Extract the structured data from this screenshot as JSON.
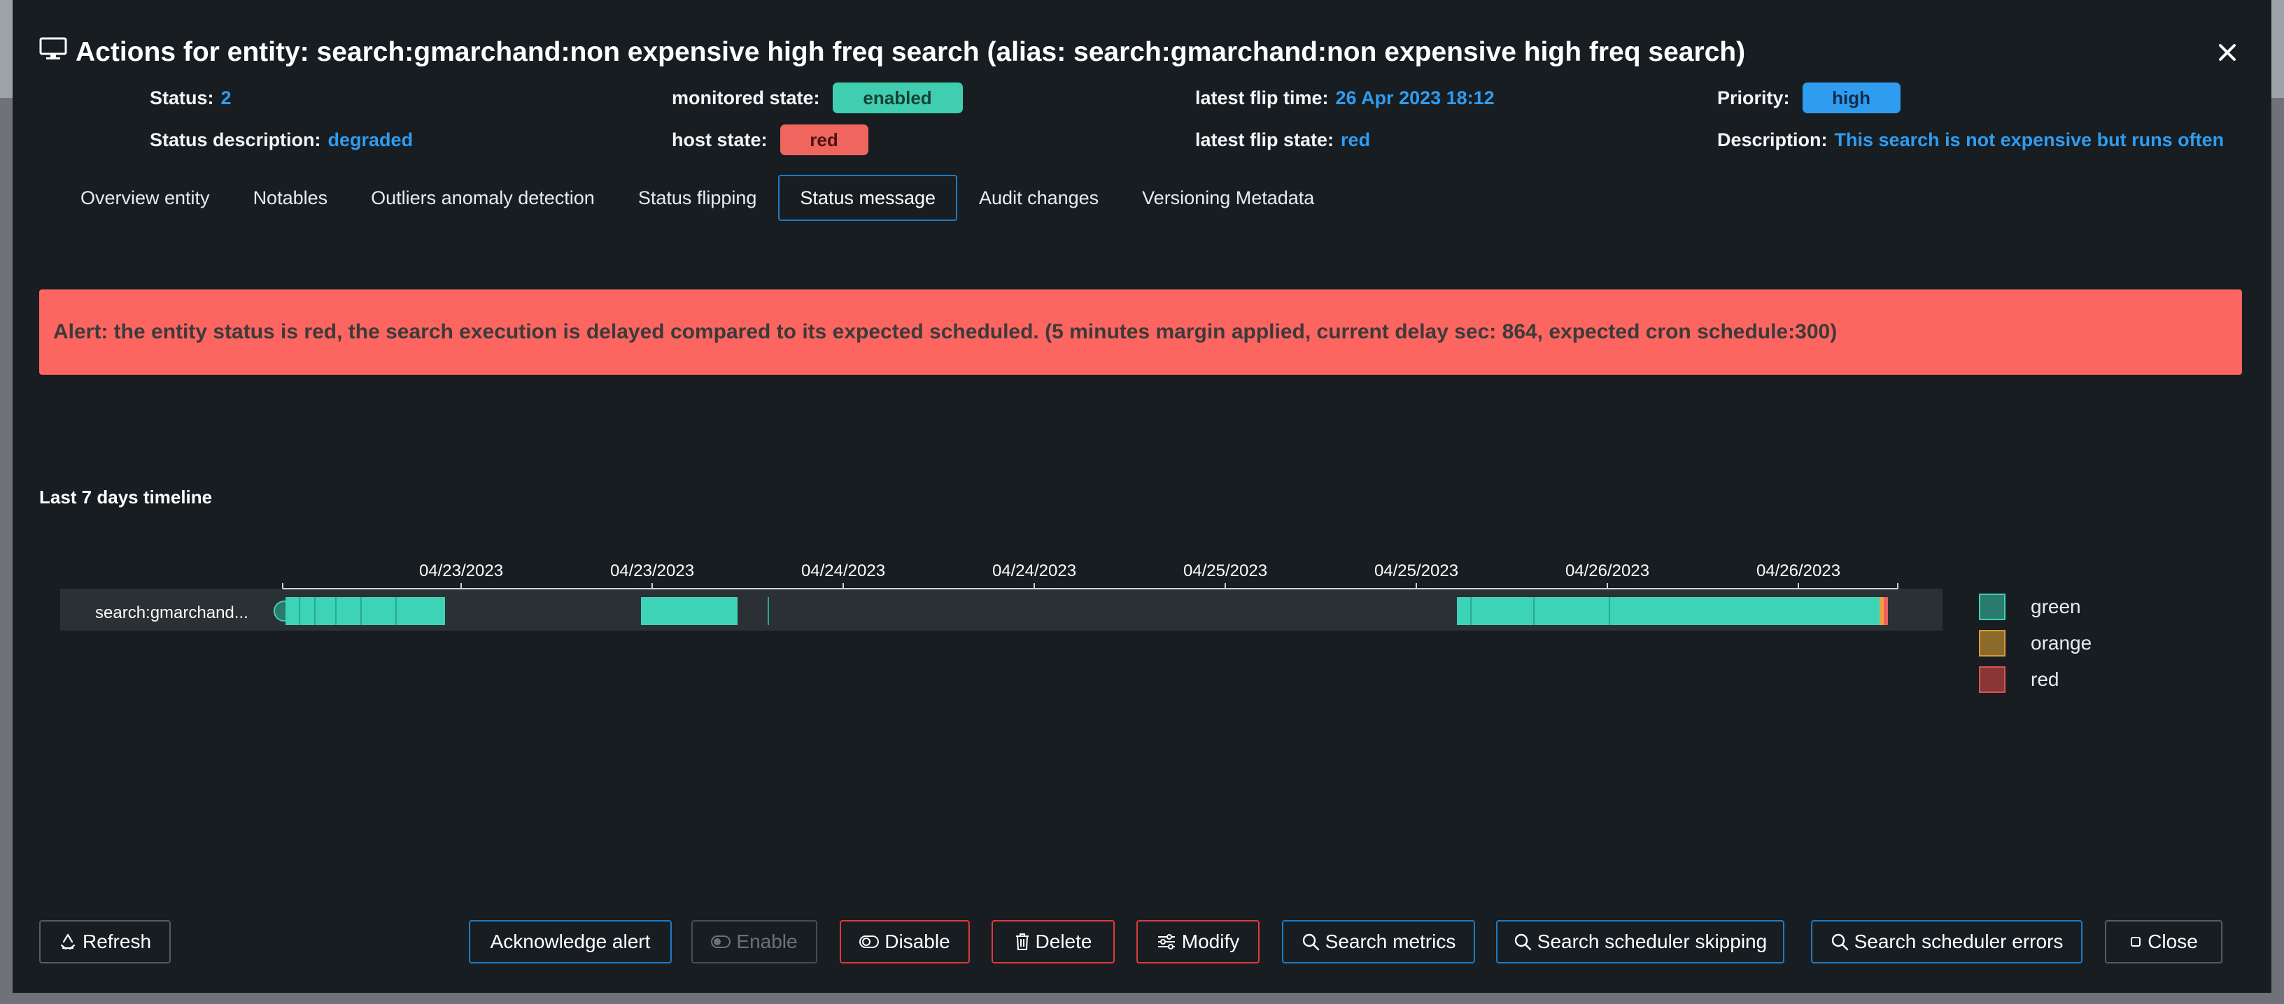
{
  "modal": {
    "title": "Actions for entity: search:gmarchand:non expensive high freq search (alias: search:gmarchand:non expensive high freq search)"
  },
  "info": {
    "status_label": "Status:",
    "status_value": "2",
    "status_desc_label": "Status description:",
    "status_desc_value": "degraded",
    "monitored_label": "monitored state:",
    "monitored_value": "enabled",
    "host_label": "host state:",
    "host_value": "red",
    "flip_time_label": "latest flip time:",
    "flip_time_value": "26 Apr 2023 18:12",
    "flip_state_label": "latest flip state:",
    "flip_state_value": "red",
    "priority_label": "Priority:",
    "priority_value": "high",
    "description_label": "Description:",
    "description_value": "This search is not expensive but runs often"
  },
  "tabs": [
    {
      "label": "Overview entity"
    },
    {
      "label": "Notables"
    },
    {
      "label": "Outliers anomaly detection"
    },
    {
      "label": "Status flipping"
    },
    {
      "label": "Status message",
      "active": true
    },
    {
      "label": "Audit changes"
    },
    {
      "label": "Versioning Metadata"
    }
  ],
  "alert": {
    "text": "Alert: the entity status is red, the search execution is delayed compared to its expected scheduled. (5 minutes margin applied, current delay sec: 864, expected cron schedule:300)"
  },
  "timeline": {
    "title": "Last 7 days timeline",
    "row_label": "search:gmarchand...",
    "ticks": [
      "04/23/2023",
      "04/23/2023",
      "04/24/2023",
      "04/24/2023",
      "04/25/2023",
      "04/25/2023",
      "04/26/2023",
      "04/26/2023"
    ],
    "legend": [
      {
        "label": "green",
        "color": "#2b7a6e",
        "border": "#3fcfb0"
      },
      {
        "label": "orange",
        "color": "#8a6a2a",
        "border": "#d89a3a"
      },
      {
        "label": "red",
        "color": "#8a3636",
        "border": "#d95454"
      }
    ],
    "colors": {
      "green": "#3dd3b6",
      "orange": "#f0a040",
      "red": "#f06060"
    }
  },
  "buttons": {
    "refresh": "Refresh",
    "acknowledge": "Acknowledge alert",
    "enable": "Enable",
    "disable": "Disable",
    "delete": "Delete",
    "modify": "Modify",
    "search_metrics": "Search metrics",
    "search_skipping": "Search scheduler skipping",
    "search_errors": "Search scheduler errors",
    "close": "Close"
  }
}
